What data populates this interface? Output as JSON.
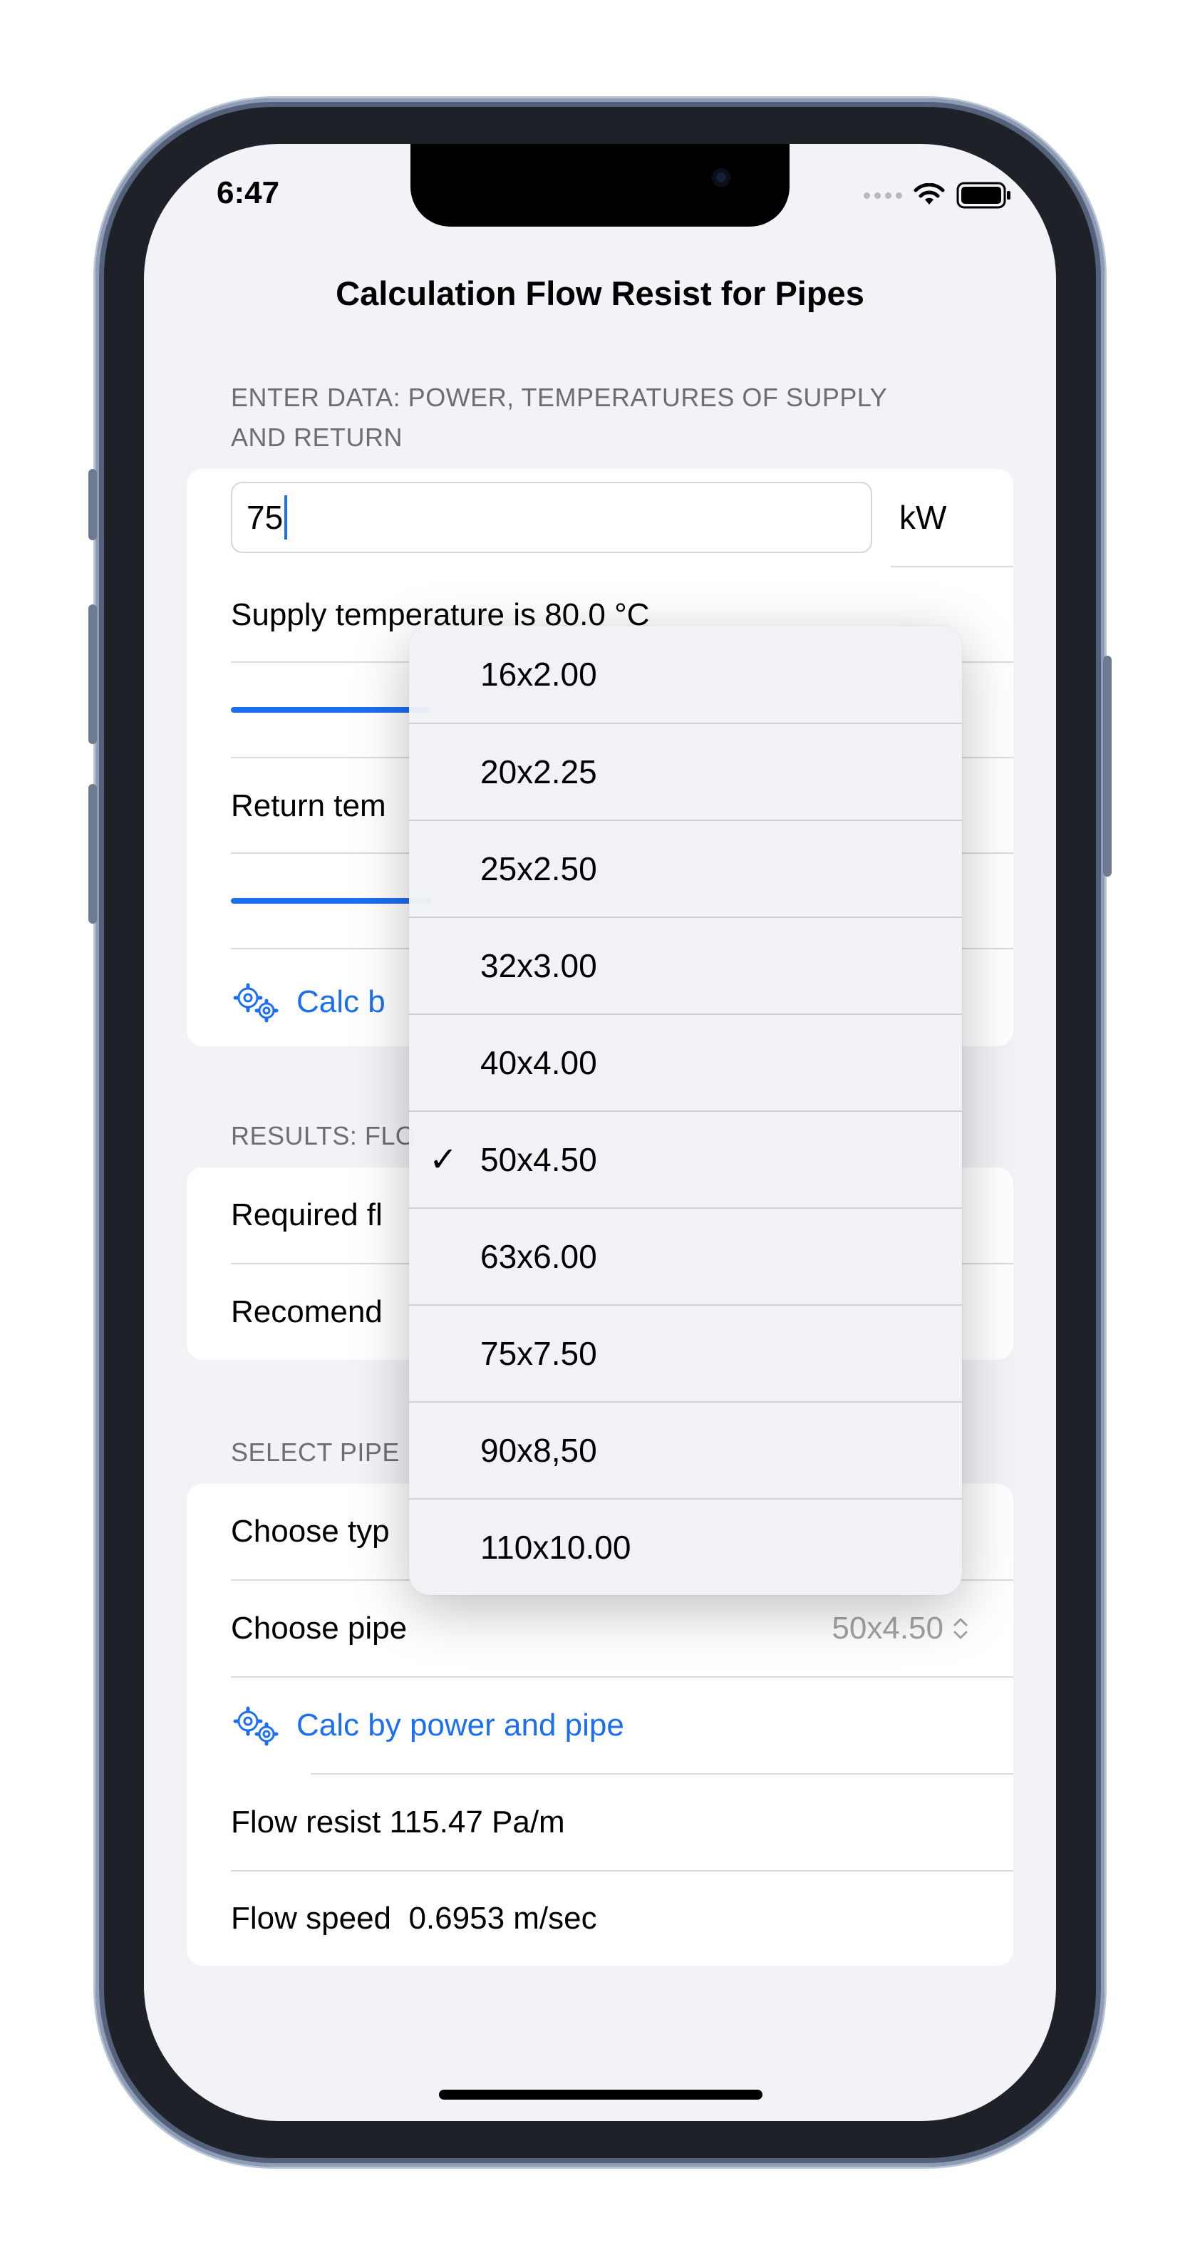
{
  "status_bar": {
    "time": "6:47"
  },
  "nav": {
    "title": "Calculation Flow Resist for Pipes"
  },
  "input_section": {
    "header_line1": "ENTER DATA: POWER, TEMPERATURES OF SUPPLY",
    "header_line2": "AND RETURN",
    "power_value": "75",
    "power_unit": "kW",
    "supply_label": "Supply temperature is 80.0 °C",
    "return_label": "Return tem",
    "calc_button": "Calc b"
  },
  "results_section": {
    "header": "RESULTS: FLO",
    "required_label": "Required fl",
    "recommend_label": "Recomend"
  },
  "pipe_section": {
    "header": "SELECT PIPE",
    "choose_type_label": "Choose typ",
    "choose_pipe_label": "Choose pipe",
    "choose_pipe_value": "50x4.50",
    "calc_button": "Calc by power and pipe",
    "flow_resist": "Flow resist 115.47 Pa/m",
    "flow_speed": "Flow speed  0.6953 m/sec"
  },
  "pipe_menu": {
    "selected": "50x4.50",
    "items": [
      "16x2.00",
      "20x2.25",
      "25x2.50",
      "32x3.00",
      "40x4.00",
      "50x4.50",
      "63x6.00",
      "75x7.50",
      "90x8,50",
      "110x10.00"
    ]
  },
  "colors": {
    "accent": "#1c6ff0",
    "background": "#f2f2f7",
    "secondary_text": "#6d6d72"
  }
}
